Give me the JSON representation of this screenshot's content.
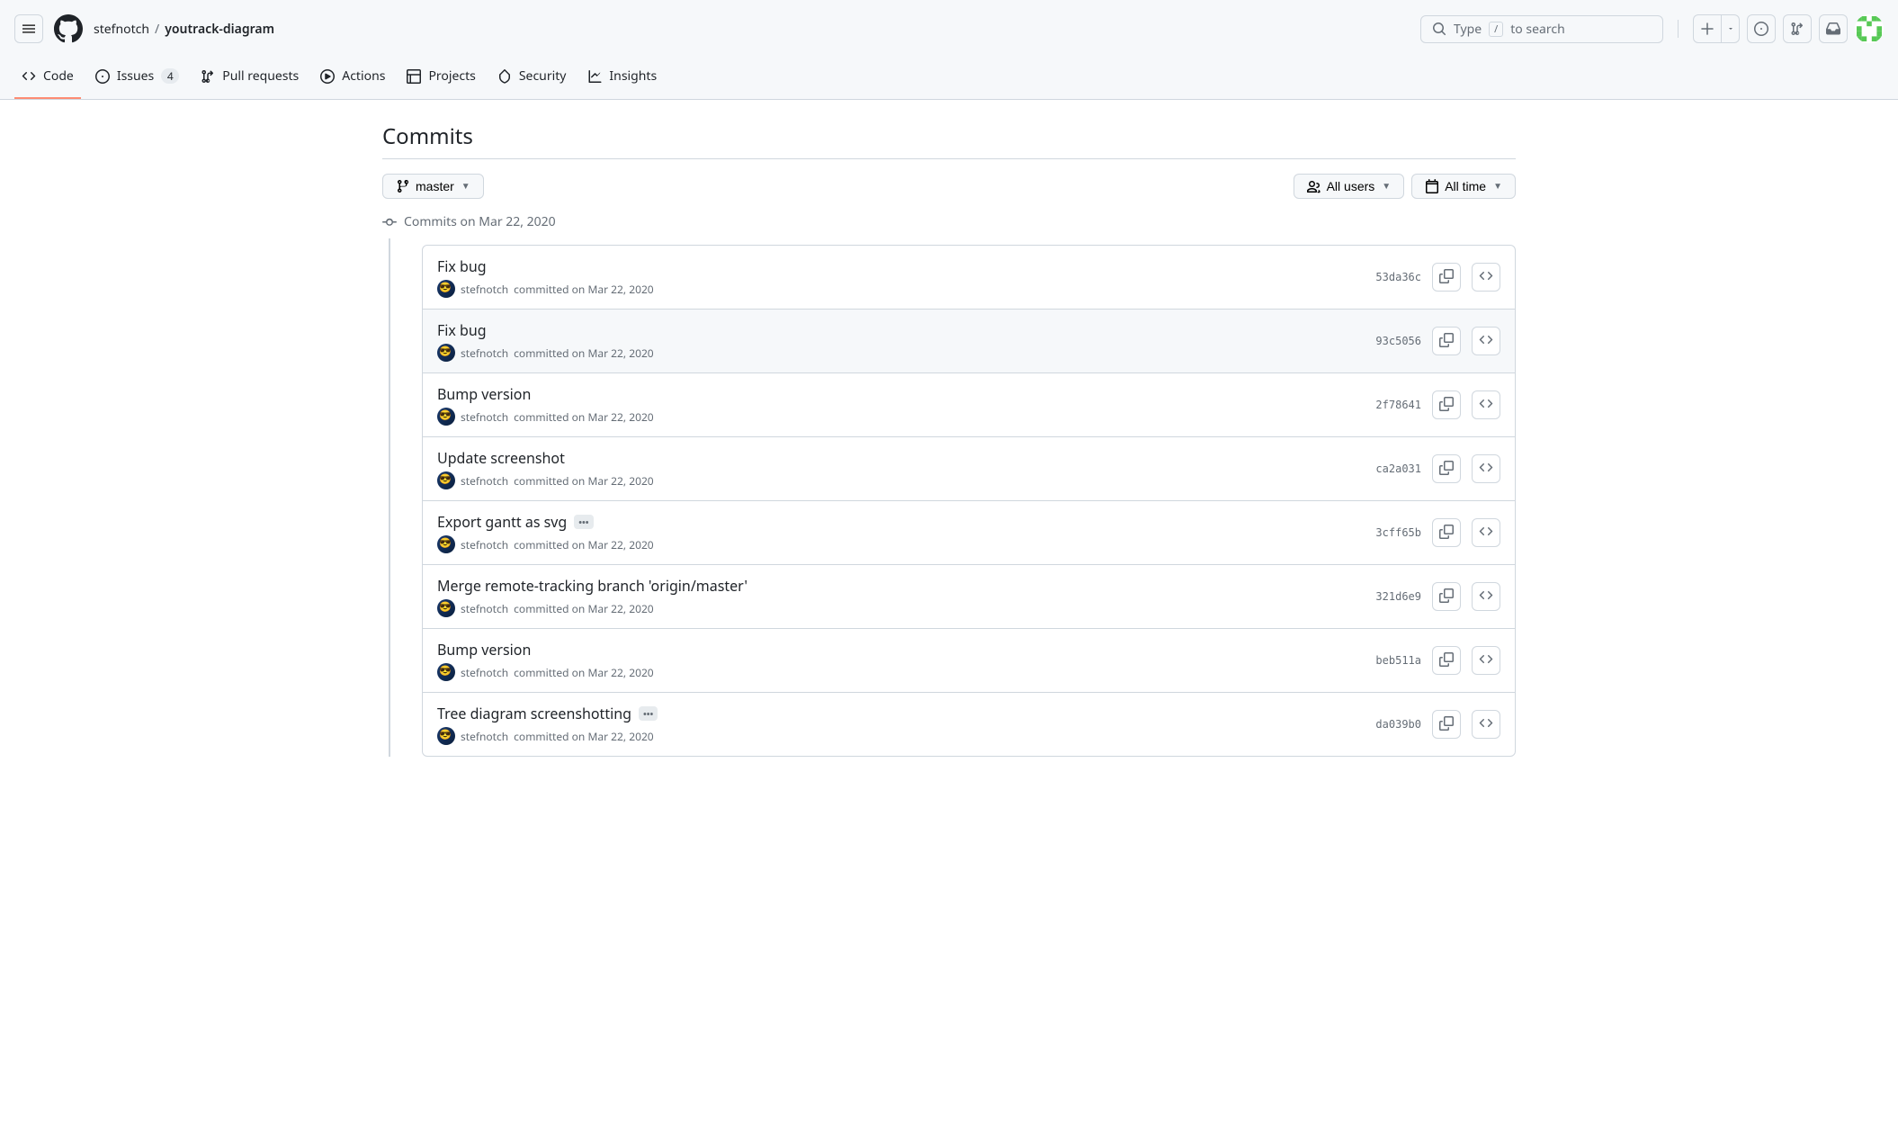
{
  "header": {
    "owner": "stefnotch",
    "separator": "/",
    "repo": "youtrack-diagram",
    "search_prefix": "Type",
    "search_key": "/",
    "search_suffix": "to search"
  },
  "nav": {
    "code": "Code",
    "issues": "Issues",
    "issues_count": "4",
    "pulls": "Pull requests",
    "actions": "Actions",
    "projects": "Projects",
    "security": "Security",
    "insights": "Insights"
  },
  "page": {
    "title": "Commits",
    "branch": "master",
    "users_filter": "All users",
    "time_filter": "All time"
  },
  "group_date": "Commits on Mar 22, 2020",
  "commits": [
    {
      "title": "Fix bug",
      "author": "stefnotch",
      "meta": "committed on Mar 22, 2020",
      "sha": "53da36c",
      "ellipsis": false,
      "hover": false
    },
    {
      "title": "Fix bug",
      "author": "stefnotch",
      "meta": "committed on Mar 22, 2020",
      "sha": "93c5056",
      "ellipsis": false,
      "hover": true
    },
    {
      "title": "Bump version",
      "author": "stefnotch",
      "meta": "committed on Mar 22, 2020",
      "sha": "2f78641",
      "ellipsis": false,
      "hover": false
    },
    {
      "title": "Update screenshot",
      "author": "stefnotch",
      "meta": "committed on Mar 22, 2020",
      "sha": "ca2a031",
      "ellipsis": false,
      "hover": false
    },
    {
      "title": "Export gantt as svg",
      "author": "stefnotch",
      "meta": "committed on Mar 22, 2020",
      "sha": "3cff65b",
      "ellipsis": true,
      "hover": false
    },
    {
      "title": "Merge remote-tracking branch 'origin/master'",
      "author": "stefnotch",
      "meta": "committed on Mar 22, 2020",
      "sha": "321d6e9",
      "ellipsis": false,
      "hover": false
    },
    {
      "title": "Bump version",
      "author": "stefnotch",
      "meta": "committed on Mar 22, 2020",
      "sha": "beb511a",
      "ellipsis": false,
      "hover": false
    },
    {
      "title": "Tree diagram screenshotting",
      "author": "stefnotch",
      "meta": "committed on Mar 22, 2020",
      "sha": "da039b0",
      "ellipsis": true,
      "hover": false
    }
  ]
}
